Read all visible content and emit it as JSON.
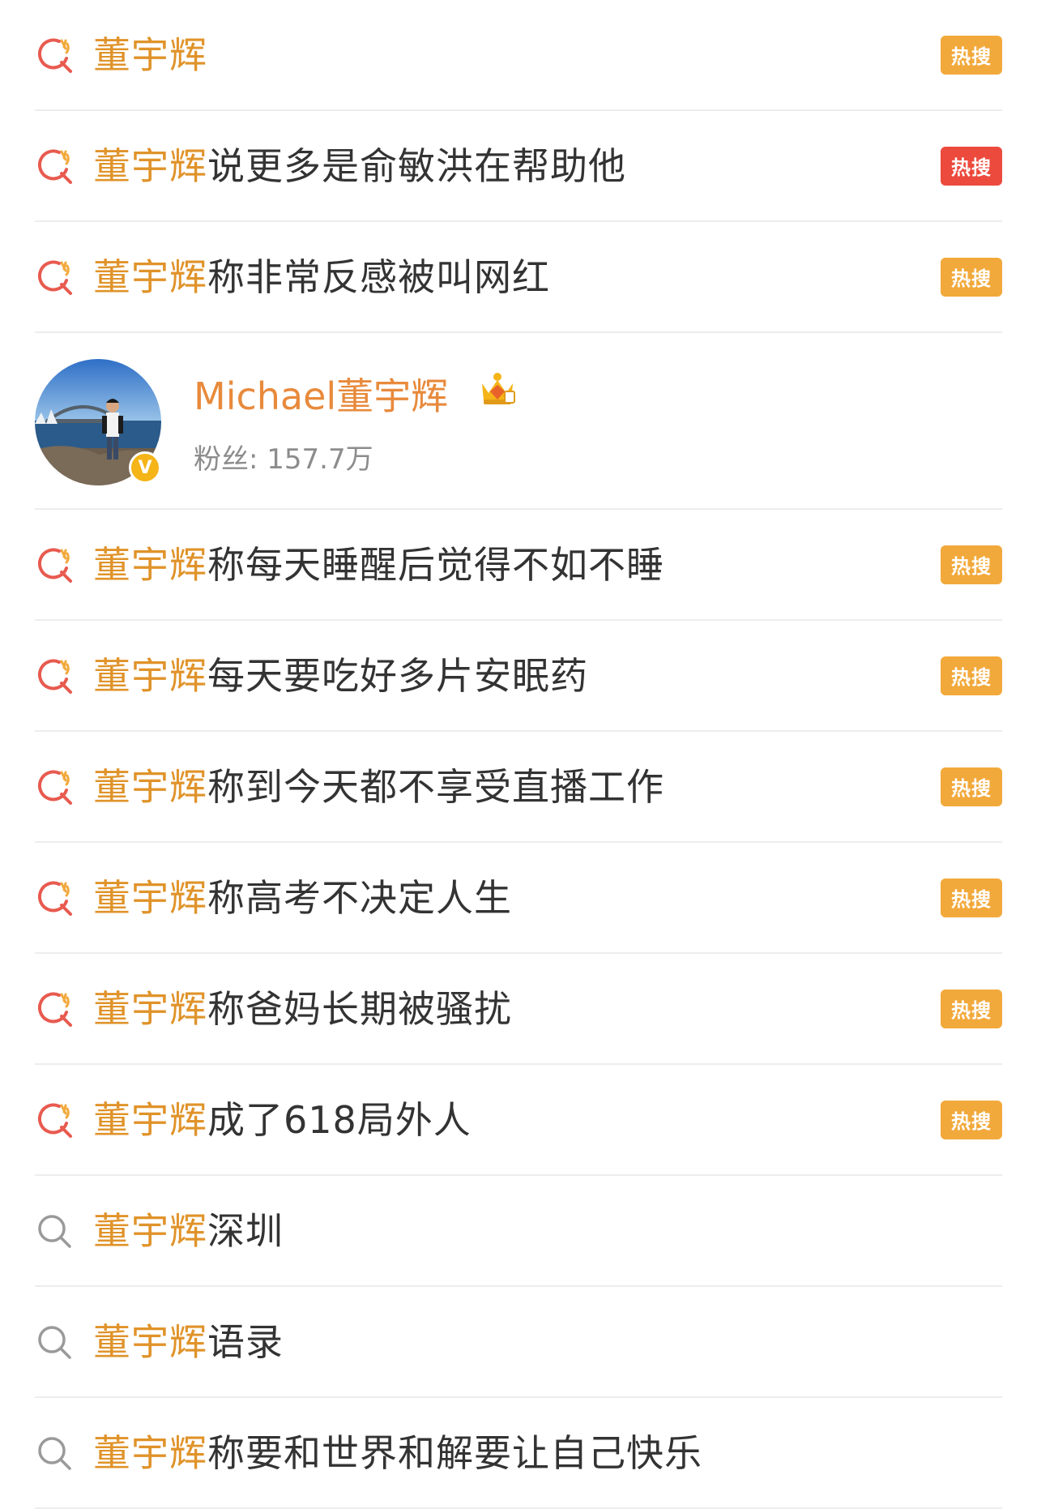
{
  "colors": {
    "highlight": "#e0932a",
    "text": "#333333",
    "badge_orange": "#f2a93b",
    "badge_red": "#ec4a3d",
    "divider": "#ededed",
    "hot_icon_ring": "#e85a4f",
    "hot_icon_spark": "#f2a93b",
    "plain_icon": "#9a9a9a"
  },
  "top_rows": [
    {
      "icon": "hot-search-icon",
      "keyword": "董宇辉",
      "rest": "",
      "badge": "热搜",
      "badge_color": "#f2a93b"
    },
    {
      "icon": "hot-search-icon",
      "keyword": "董宇辉",
      "rest": "说更多是俞敏洪在帮助他",
      "badge": "热搜",
      "badge_color": "#ec4a3d"
    },
    {
      "icon": "hot-search-icon",
      "keyword": "董宇辉",
      "rest": "称非常反感被叫网红",
      "badge": "热搜",
      "badge_color": "#f2a93b"
    }
  ],
  "user": {
    "name": "Michael董宇辉",
    "fans": "粉丝: 157.7万",
    "verified_mark": "V",
    "crown_icon": "crown-icon"
  },
  "bottom_rows": [
    {
      "icon": "hot-search-icon",
      "keyword": "董宇辉",
      "rest": "称每天睡醒后觉得不如不睡",
      "badge": "热搜",
      "badge_color": "#f2a93b"
    },
    {
      "icon": "hot-search-icon",
      "keyword": "董宇辉",
      "rest": "每天要吃好多片安眠药",
      "badge": "热搜",
      "badge_color": "#f2a93b"
    },
    {
      "icon": "hot-search-icon",
      "keyword": "董宇辉",
      "rest": "称到今天都不享受直播工作",
      "badge": "热搜",
      "badge_color": "#f2a93b"
    },
    {
      "icon": "hot-search-icon",
      "keyword": "董宇辉",
      "rest": "称高考不决定人生",
      "badge": "热搜",
      "badge_color": "#f2a93b"
    },
    {
      "icon": "hot-search-icon",
      "keyword": "董宇辉",
      "rest": "称爸妈长期被骚扰",
      "badge": "热搜",
      "badge_color": "#f2a93b"
    },
    {
      "icon": "hot-search-icon",
      "keyword": "董宇辉",
      "rest": "成了618局外人",
      "badge": "热搜",
      "badge_color": "#f2a93b"
    },
    {
      "icon": "search-icon",
      "keyword": "董宇辉",
      "rest": "深圳",
      "badge": "",
      "badge_color": ""
    },
    {
      "icon": "search-icon",
      "keyword": "董宇辉",
      "rest": "语录",
      "badge": "",
      "badge_color": ""
    },
    {
      "icon": "search-icon",
      "keyword": "董宇辉",
      "rest": "称要和世界和解要让自己快乐",
      "badge": "",
      "badge_color": ""
    }
  ]
}
